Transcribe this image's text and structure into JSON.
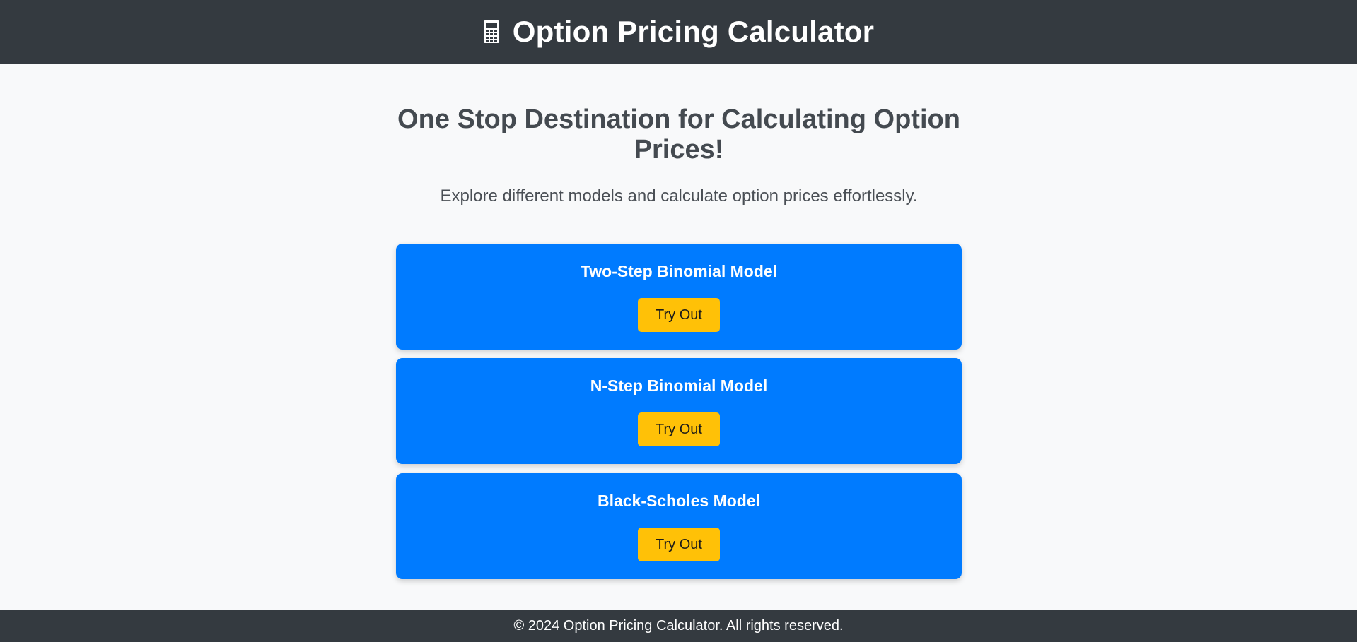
{
  "header": {
    "icon": "calculator-icon",
    "title": "Option Pricing Calculator"
  },
  "main": {
    "headline": "One Stop Destination for Calculating Option Prices!",
    "subtext": "Explore different models and calculate option prices effortlessly.",
    "cards": [
      {
        "title": "Two-Step Binomial Model",
        "button_label": "Try Out"
      },
      {
        "title": "N-Step Binomial Model",
        "button_label": "Try Out"
      },
      {
        "title": "Black-Scholes Model",
        "button_label": "Try Out"
      }
    ]
  },
  "footer": {
    "text": "© 2024 Option Pricing Calculator. All rights reserved."
  },
  "colors": {
    "header_bg": "#343a40",
    "page_bg": "#f8f9fa",
    "card_bg": "#007bff",
    "button_bg": "#ffc107"
  }
}
